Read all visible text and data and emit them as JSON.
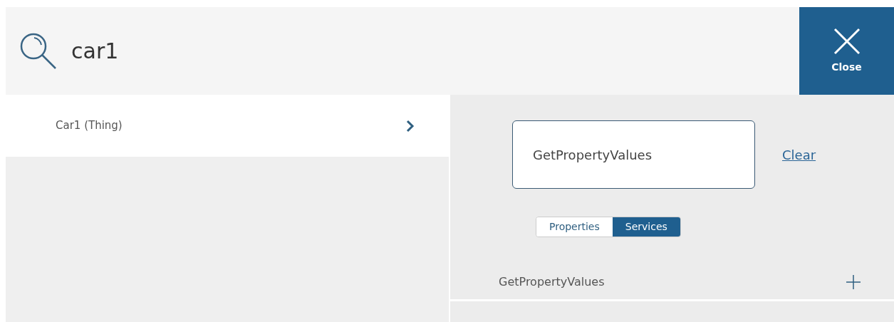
{
  "search": {
    "value": "car1"
  },
  "close_button": {
    "label": "Close"
  },
  "results": [
    {
      "label": "Car1 (Thing)",
      "selected": true
    }
  ],
  "filter": {
    "value": "GetPropertyValues",
    "clear_label": "Clear"
  },
  "tabs": [
    {
      "label": "Properties",
      "selected": false
    },
    {
      "label": "Services",
      "selected": true
    }
  ],
  "items": [
    {
      "label": "GetPropertyValues"
    }
  ]
}
